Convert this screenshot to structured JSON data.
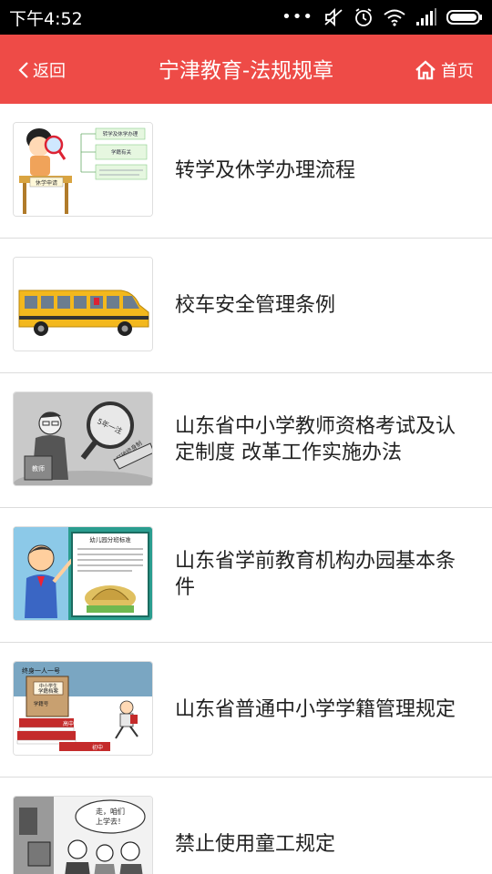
{
  "status_bar": {
    "time": "下午4:52"
  },
  "header": {
    "back_label": "返回",
    "title": "宁津教育-法规规章",
    "home_label": "首页"
  },
  "articles": [
    {
      "title": "转学及休学办理流程",
      "thumb_texts": [
        "转学及休学办理",
        "学籍有关",
        "休学申请"
      ]
    },
    {
      "title": "校车安全管理条例",
      "thumb_texts": []
    },
    {
      "title": "山东省中小学教师资格考试及认定制度 改革工作实施办法",
      "thumb_texts": [
        "教师",
        "5年一注",
        "打破终身制"
      ]
    },
    {
      "title": "山东省学前教育机构办园基本条件",
      "thumb_texts": [
        "幼儿园分班标准"
      ]
    },
    {
      "title": "山东省普通中小学学籍管理规定",
      "thumb_texts": [
        "终身一人一号",
        "中小学生",
        "学籍档案",
        "学籍号",
        "高中",
        "初中"
      ]
    },
    {
      "title": "禁止使用童工规定",
      "thumb_texts": [
        "走，咱们",
        "上学去！"
      ]
    }
  ],
  "colors": {
    "accent": "#ee4b47",
    "status_bar": "#000000",
    "divider": "#dcdcdc"
  }
}
